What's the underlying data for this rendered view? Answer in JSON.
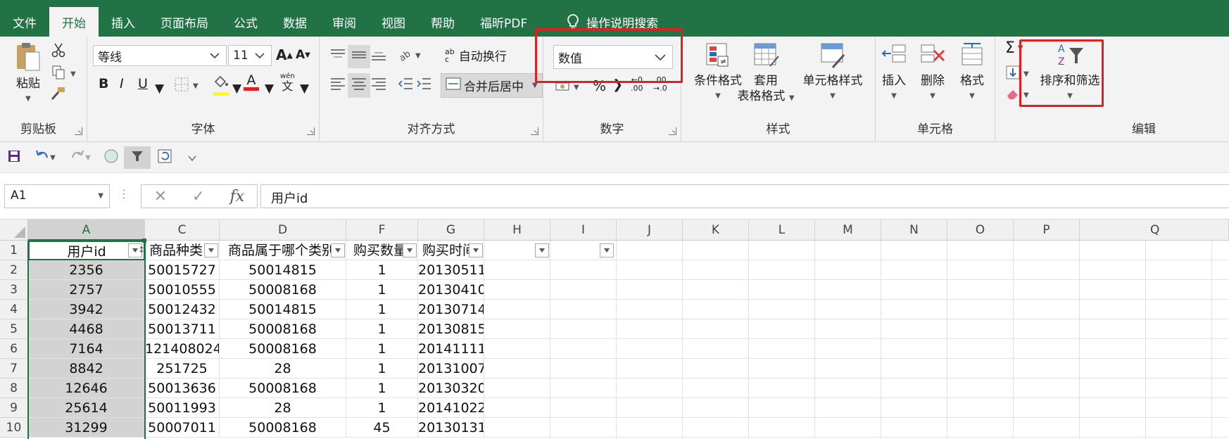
{
  "tabs": [
    "文件",
    "开始",
    "插入",
    "页面布局",
    "公式",
    "数据",
    "审阅",
    "视图",
    "帮助",
    "福昕PDF"
  ],
  "active_tab": "开始",
  "tell_me": "操作说明搜索",
  "clipboard": {
    "label": "剪贴板",
    "paste": "粘贴"
  },
  "font": {
    "label": "字体",
    "name": "等线",
    "size": "11",
    "grow": "A",
    "shrink": "A",
    "bold": "B",
    "italic": "I",
    "underline": "U",
    "font_color_glyph": "A",
    "phonetic_top": "wén",
    "phonetic_bottom": "文"
  },
  "alignment": {
    "label": "对齐方式",
    "wrap": "自动换行",
    "merge": "合并后居中",
    "wrap_glyph_top": "ab",
    "wrap_glyph_bottom": "c"
  },
  "number": {
    "label": "数字",
    "format": "数值",
    "percent": "%",
    "comma": "❯",
    "inc_decimal_top": "←0",
    "inc_decimal_bottom": ".00",
    "dec_decimal_top": ".00",
    "dec_decimal_bottom": "→.0"
  },
  "styles": {
    "label": "样式",
    "conditional": "条件格式",
    "table_line1": "套用",
    "table_line2": "表格格式",
    "cell_styles": "单元格样式"
  },
  "cells": {
    "label": "单元格",
    "insert": "插入",
    "delete": "删除",
    "format": "格式"
  },
  "editing": {
    "label": "编辑",
    "sort_filter": "排序和筛选",
    "sigma": "Σ"
  },
  "name_box": "A1",
  "formula_icons": {
    "cancel": "✕",
    "enter": "✓",
    "fx": "fx"
  },
  "formula_value": "用户id",
  "columns": [
    "A",
    "C",
    "D",
    "F",
    "G",
    "H",
    "I",
    "J",
    "K",
    "L",
    "M",
    "N",
    "O",
    "P",
    "Q"
  ],
  "rows": [
    "1",
    "2",
    "3",
    "4",
    "5",
    "6",
    "7",
    "8",
    "9",
    "10"
  ],
  "headers": [
    "用户id",
    "商品种类",
    "商品属于哪个类别",
    "购买数量",
    "购买时间",
    "",
    ""
  ],
  "table": [
    [
      "2356",
      "50015727",
      "50014815",
      "1",
      "20130511"
    ],
    [
      "2757",
      "50010555",
      "50008168",
      "1",
      "20130410"
    ],
    [
      "3942",
      "50012432",
      "50014815",
      "1",
      "20130714"
    ],
    [
      "4468",
      "50013711",
      "50008168",
      "1",
      "20130815"
    ],
    [
      "7164",
      "121408024",
      "50008168",
      "1",
      "20141111"
    ],
    [
      "8842",
      "251725",
      "28",
      "1",
      "20131007"
    ],
    [
      "12646",
      "50013636",
      "50008168",
      "1",
      "20130320"
    ],
    [
      "25614",
      "50011993",
      "28",
      "1",
      "20141022"
    ],
    [
      "31299",
      "50007011",
      "50008168",
      "45",
      "20130131"
    ]
  ],
  "colors": {
    "brand": "#217346",
    "highlight": "#e02020",
    "selection": "#d3d3d3"
  }
}
